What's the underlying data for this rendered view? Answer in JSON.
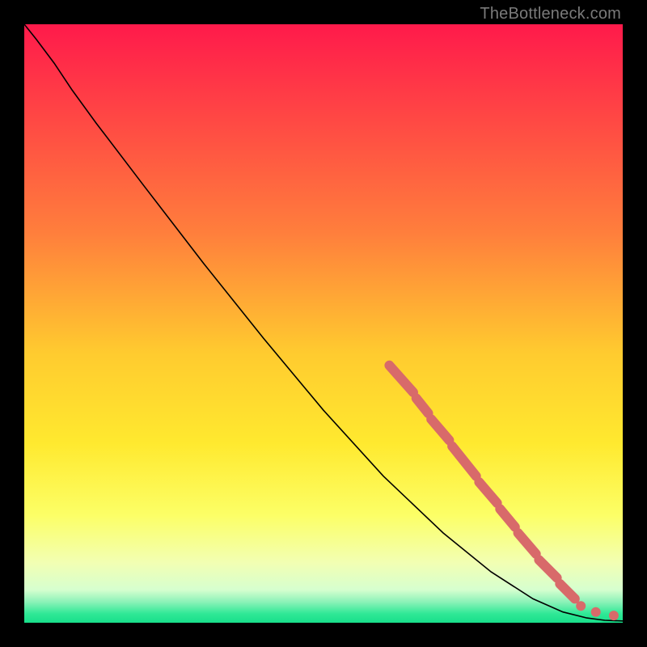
{
  "watermark": "TheBottleneck.com",
  "colors": {
    "line": "#000000",
    "marker": "#d86a6a",
    "frame_bg": "#000000"
  },
  "chart_data": {
    "type": "line",
    "title": "",
    "xlabel": "",
    "ylabel": "",
    "xlim": [
      0,
      100
    ],
    "ylim": [
      0,
      100
    ],
    "gradient_stops": [
      {
        "pos": 0.0,
        "color": "#ff1a4b"
      },
      {
        "pos": 0.35,
        "color": "#ff7f3c"
      },
      {
        "pos": 0.55,
        "color": "#ffcb2f"
      },
      {
        "pos": 0.7,
        "color": "#ffe92f"
      },
      {
        "pos": 0.82,
        "color": "#fcff66"
      },
      {
        "pos": 0.9,
        "color": "#f2ffb3"
      },
      {
        "pos": 0.945,
        "color": "#d6ffcf"
      },
      {
        "pos": 0.965,
        "color": "#8cf2b8"
      },
      {
        "pos": 0.985,
        "color": "#2fe896"
      },
      {
        "pos": 1.0,
        "color": "#18df8a"
      }
    ],
    "curve": [
      {
        "x": 0.0,
        "y": 100.0
      },
      {
        "x": 2.0,
        "y": 97.5
      },
      {
        "x": 5.0,
        "y": 93.5
      },
      {
        "x": 8.0,
        "y": 89.0
      },
      {
        "x": 12.0,
        "y": 83.5
      },
      {
        "x": 20.0,
        "y": 73.0
      },
      {
        "x": 30.0,
        "y": 60.0
      },
      {
        "x": 40.0,
        "y": 47.5
      },
      {
        "x": 50.0,
        "y": 35.5
      },
      {
        "x": 60.0,
        "y": 24.5
      },
      {
        "x": 70.0,
        "y": 15.0
      },
      {
        "x": 78.0,
        "y": 8.5
      },
      {
        "x": 85.0,
        "y": 4.0
      },
      {
        "x": 90.0,
        "y": 1.8
      },
      {
        "x": 94.0,
        "y": 0.8
      },
      {
        "x": 97.0,
        "y": 0.4
      },
      {
        "x": 100.0,
        "y": 0.3
      }
    ],
    "marker_segments": [
      {
        "x1": 61.0,
        "y1": 43.0,
        "x2": 65.0,
        "y2": 38.5
      },
      {
        "x1": 65.5,
        "y1": 37.5,
        "x2": 67.5,
        "y2": 35.0
      },
      {
        "x1": 68.0,
        "y1": 34.0,
        "x2": 71.0,
        "y2": 30.5
      },
      {
        "x1": 71.5,
        "y1": 29.5,
        "x2": 75.5,
        "y2": 24.5
      },
      {
        "x1": 76.0,
        "y1": 23.5,
        "x2": 79.0,
        "y2": 20.0
      },
      {
        "x1": 79.5,
        "y1": 19.0,
        "x2": 82.0,
        "y2": 16.0
      },
      {
        "x1": 82.5,
        "y1": 15.0,
        "x2": 85.5,
        "y2": 11.5
      },
      {
        "x1": 86.0,
        "y1": 10.5,
        "x2": 89.0,
        "y2": 7.5
      },
      {
        "x1": 89.5,
        "y1": 6.5,
        "x2": 92.0,
        "y2": 4.0
      }
    ],
    "marker_dots": [
      {
        "x": 93.0,
        "y": 2.8
      },
      {
        "x": 95.5,
        "y": 1.8
      },
      {
        "x": 98.5,
        "y": 1.2
      }
    ]
  }
}
